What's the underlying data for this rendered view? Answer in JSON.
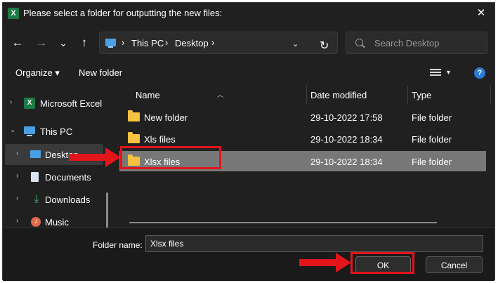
{
  "window": {
    "title": "Please select a folder for outputting the new files:",
    "app_icon_letter": "X",
    "close_glyph": "✕"
  },
  "navigation": {
    "back_glyph": "←",
    "forward_glyph": "→",
    "recent_glyph": "⌄",
    "up_glyph": "↑",
    "breadcrumb": [
      "This PC",
      "Desktop"
    ],
    "breadcrumb_sep": "›",
    "dropdown_glyph": "⌄",
    "refresh_glyph": "↻",
    "search_placeholder": "Search Desktop"
  },
  "toolbar": {
    "organize_label": "Organize ▾",
    "new_folder_label": "New folder",
    "view_caret": "▾",
    "help_glyph": "?"
  },
  "nav_pane": {
    "items": [
      {
        "label": "Microsoft Excel",
        "icon": "excel-icon",
        "chevron": "›",
        "selected": false
      },
      {
        "label": "This PC",
        "icon": "computer-icon",
        "chevron": "⌄",
        "selected": false
      },
      {
        "label": "Desktop",
        "icon": "desktop-icon",
        "chevron": "›",
        "selected": true
      },
      {
        "label": "Documents",
        "icon": "documents-icon",
        "chevron": "›",
        "selected": false
      },
      {
        "label": "Downloads",
        "icon": "downloads-icon",
        "chevron": "›",
        "selected": false
      },
      {
        "label": "Music",
        "icon": "music-icon",
        "chevron": "›",
        "selected": false
      }
    ]
  },
  "file_list": {
    "columns": {
      "name": "Name",
      "date": "Date modified",
      "type": "Type"
    },
    "sort_glyph": "︿",
    "rows": [
      {
        "name": "New folder",
        "date": "29-10-2022 17:58",
        "type": "File folder",
        "selected": false
      },
      {
        "name": "Xls files",
        "date": "29-10-2022 18:34",
        "type": "File folder",
        "selected": false
      },
      {
        "name": "Xlsx files",
        "date": "29-10-2022 18:34",
        "type": "File folder",
        "selected": true
      }
    ]
  },
  "footer": {
    "folder_name_label": "Folder name:",
    "folder_name_value": "Xlsx files",
    "ok_label": "OK",
    "cancel_label": "Cancel"
  },
  "colors": {
    "background": "#202020",
    "selection": "#777777",
    "folder": "#f5c242",
    "annotation_red": "#e3141a",
    "accent_blue": "#2b7bd6"
  }
}
